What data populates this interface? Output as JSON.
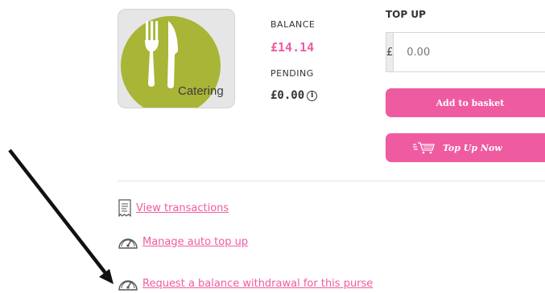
{
  "colors": {
    "accent": "#ef5ba1",
    "circle": "#a8b536",
    "arrow": "#111111"
  },
  "purse": {
    "tile_label": "Catering",
    "icon": "fork-knife-icon"
  },
  "balance": {
    "label": "BALANCE",
    "value": "£14.14",
    "pending_label": "PENDING",
    "pending_value": "£0.00",
    "info_glyph": "i"
  },
  "topup": {
    "label": "TOP UP",
    "currency_symbol": "£",
    "amount_placeholder": "0.00",
    "add_to_basket_label": "Add to basket",
    "top_up_now_label": "Top Up Now",
    "top_up_now_icon": "shopping-cart-icon"
  },
  "links": {
    "view_transactions": "View transactions",
    "manage_auto_top_up": "Manage auto top up",
    "request_withdrawal": "Request a balance withdrawal for this purse"
  },
  "annotation": {
    "arrow": "arrow pointing to withdrawal link"
  }
}
